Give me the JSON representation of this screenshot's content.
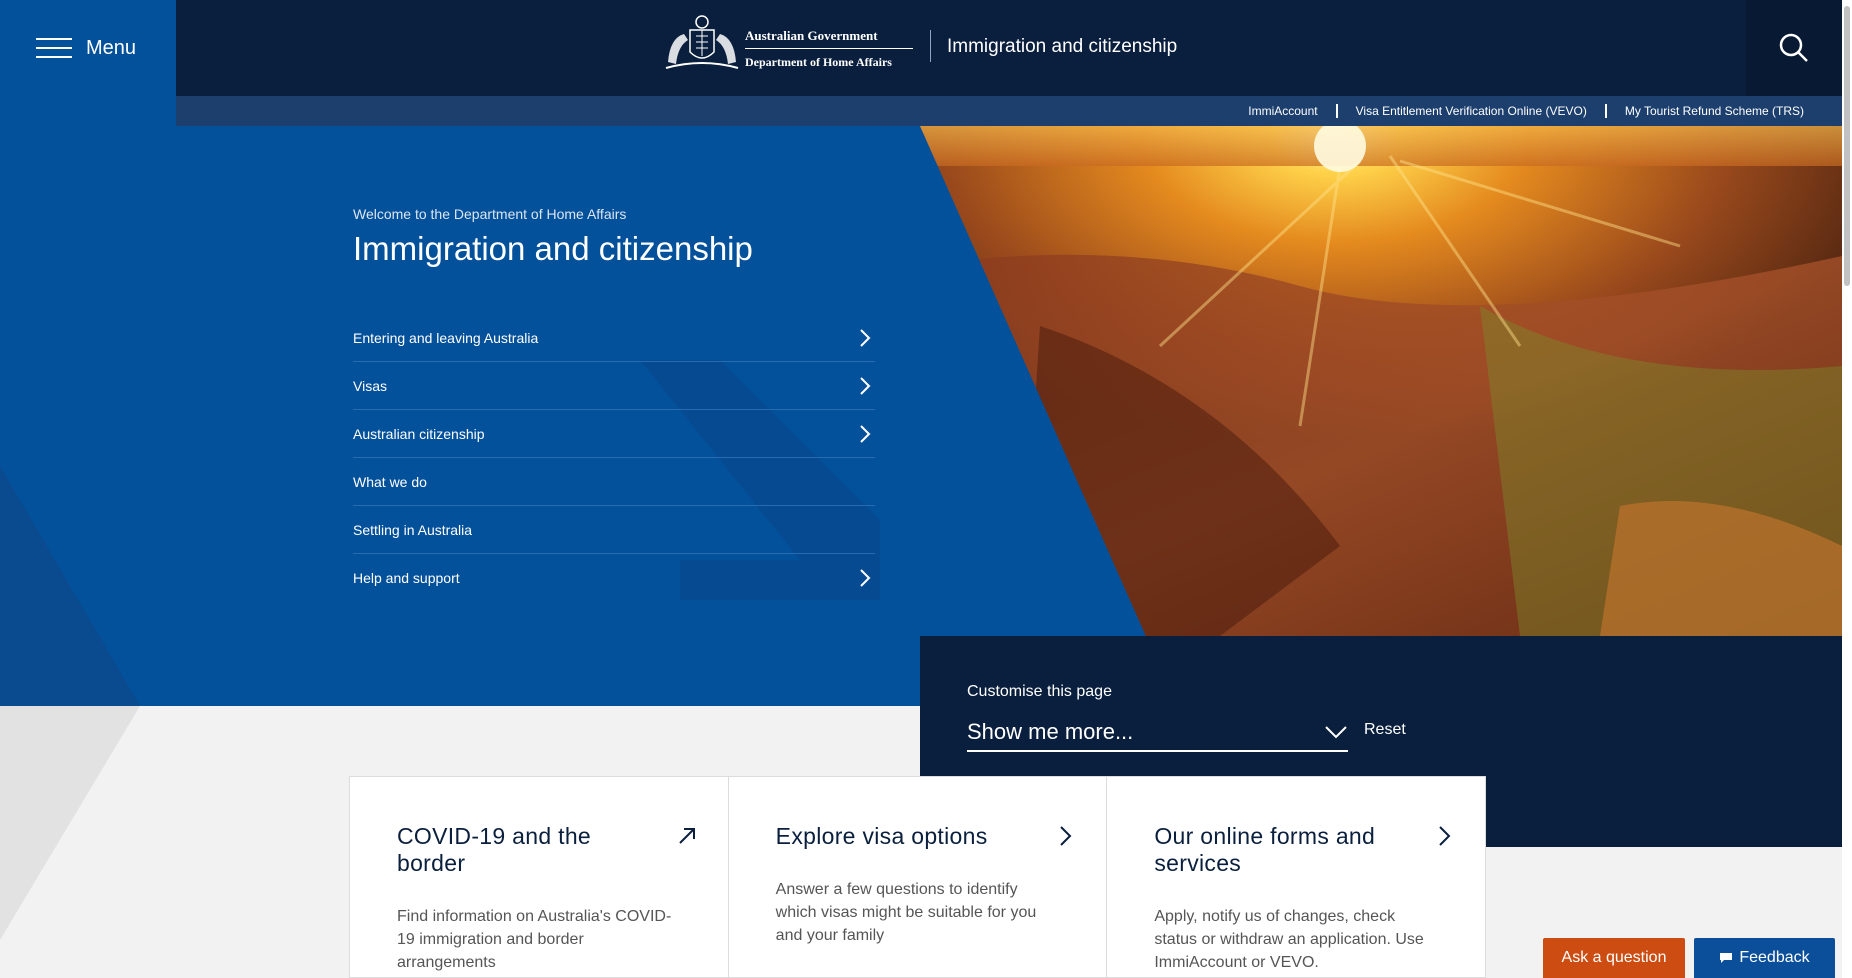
{
  "header": {
    "menu_label": "Menu",
    "gov_line1": "Australian Government",
    "gov_line2": "Department of Home Affairs",
    "site_title": "Immigration and citizenship"
  },
  "utility_links": [
    {
      "label": "ImmiAccount"
    },
    {
      "label": "Visa Entitlement Verification Online (VEVO)"
    },
    {
      "label": "My Tourist Refund Scheme (TRS)"
    }
  ],
  "hero": {
    "eyebrow": "Welcome to the Department of Home Affairs",
    "title": "Immigration and citizenship",
    "nav": [
      {
        "label": "Entering and leaving Australia",
        "has_chevron": true
      },
      {
        "label": "Visas",
        "has_chevron": true
      },
      {
        "label": "Australian citizenship",
        "has_chevron": true
      },
      {
        "label": "What we do",
        "has_chevron": false
      },
      {
        "label": "Settling in Australia",
        "has_chevron": false
      },
      {
        "label": "Help and support",
        "has_chevron": true
      }
    ]
  },
  "customise": {
    "label": "Customise this page",
    "select_value": "Show me more...",
    "reset_label": "Reset"
  },
  "cards": [
    {
      "title": "COVID-19 and the border",
      "text": "Find information on Australia's COVID-19 immigration and border arrangements",
      "icon": "external-arrow-icon"
    },
    {
      "title": "Explore visa options",
      "text": "Answer a few questions to identify which visas might be suitable for you and your family",
      "icon": "chevron-right-icon"
    },
    {
      "title": "Our online forms and services",
      "text": "Apply, notify us of changes, check status or withdraw an application. Use ImmiAccount or VEVO.",
      "icon": "chevron-right-icon"
    }
  ],
  "floating": {
    "ask_label": "Ask a question",
    "feedback_label": "Feedback"
  },
  "colors": {
    "hero_blue": "#03509b",
    "navy": "#0a1f3d",
    "ask_orange": "#cc4c12",
    "feedback_blue": "#0b4f9b"
  }
}
